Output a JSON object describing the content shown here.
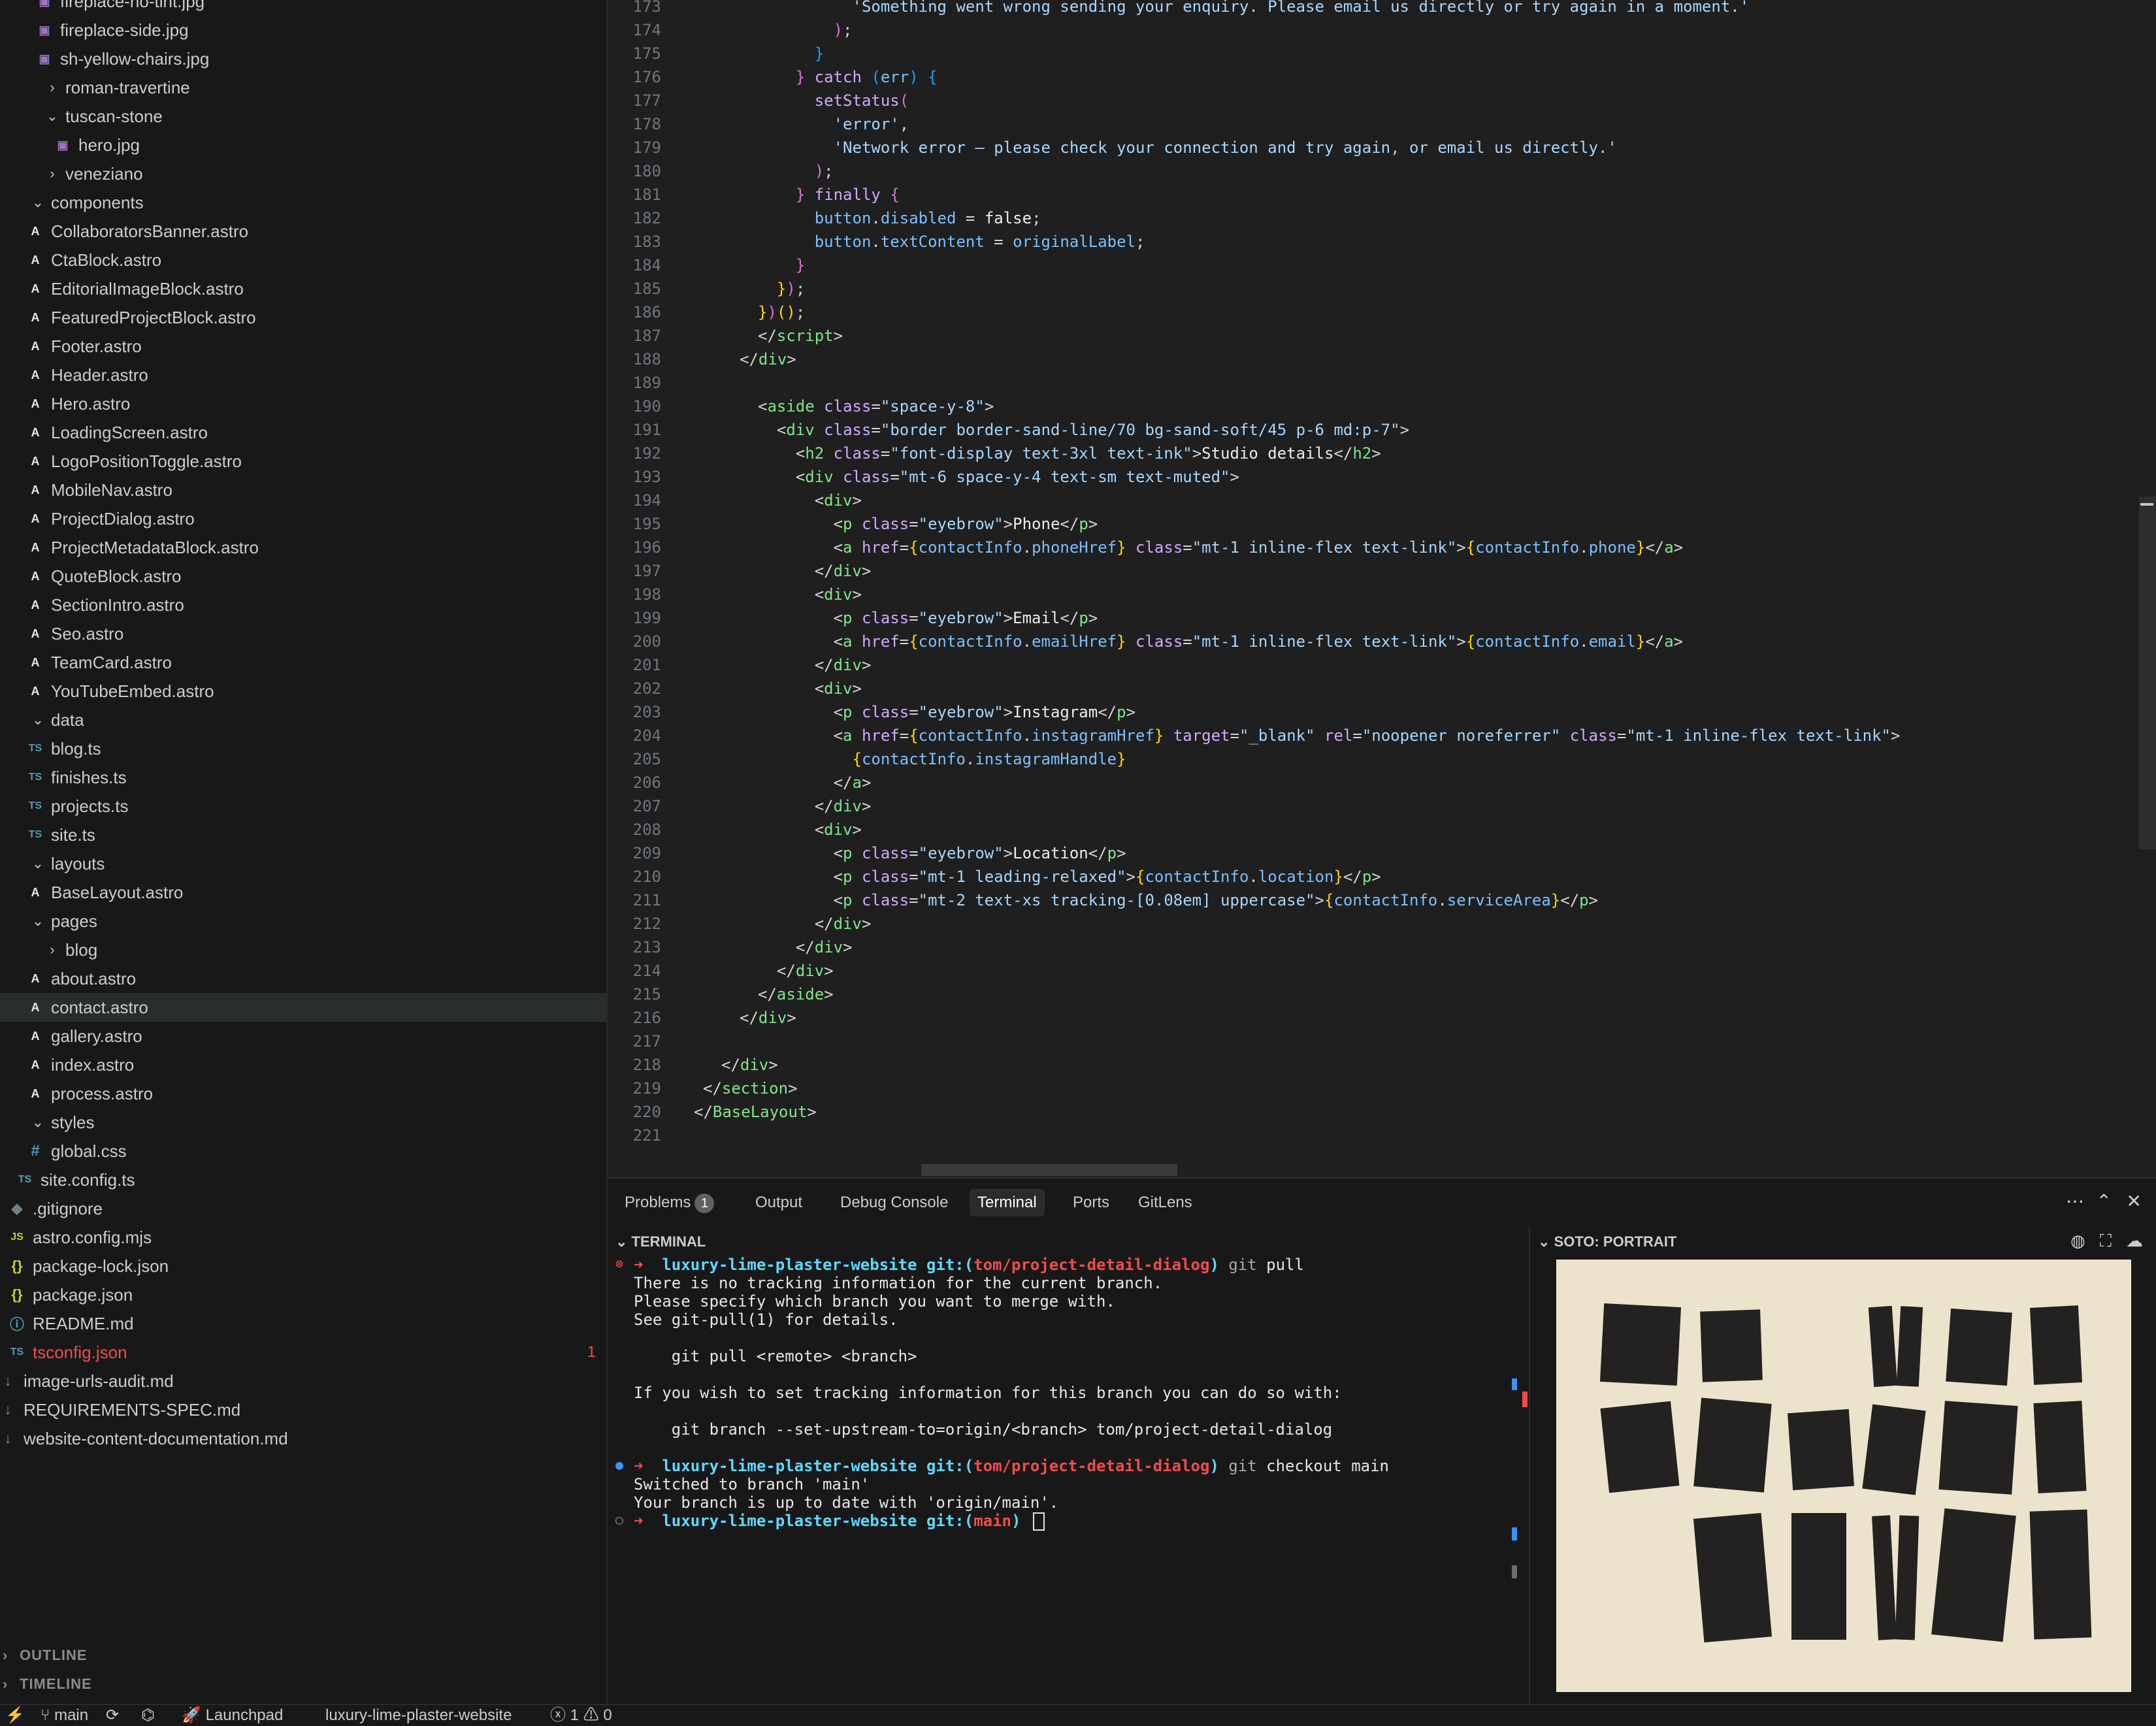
{
  "explorer": {
    "items": [
      {
        "label": "fireplace-no-tint.jpg",
        "type": "img"
      },
      {
        "label": "fireplace-side.jpg",
        "type": "img"
      },
      {
        "label": "sh-yellow-chairs.jpg",
        "type": "img"
      },
      {
        "label": "roman-travertine",
        "type": "folder-closed"
      },
      {
        "label": "tuscan-stone",
        "type": "folder-open"
      },
      {
        "label": "hero.jpg",
        "type": "img"
      },
      {
        "label": "veneziano",
        "type": "folder-closed"
      },
      {
        "label": "components",
        "type": "folder-open"
      },
      {
        "label": "CollaboratorsBanner.astro",
        "type": "astro"
      },
      {
        "label": "CtaBlock.astro",
        "type": "astro"
      },
      {
        "label": "EditorialImageBlock.astro",
        "type": "astro"
      },
      {
        "label": "FeaturedProjectBlock.astro",
        "type": "astro"
      },
      {
        "label": "Footer.astro",
        "type": "astro"
      },
      {
        "label": "Header.astro",
        "type": "astro"
      },
      {
        "label": "Hero.astro",
        "type": "astro"
      },
      {
        "label": "LoadingScreen.astro",
        "type": "astro"
      },
      {
        "label": "LogoPositionToggle.astro",
        "type": "astro"
      },
      {
        "label": "MobileNav.astro",
        "type": "astro"
      },
      {
        "label": "ProjectDialog.astro",
        "type": "astro"
      },
      {
        "label": "ProjectMetadataBlock.astro",
        "type": "astro"
      },
      {
        "label": "QuoteBlock.astro",
        "type": "astro"
      },
      {
        "label": "SectionIntro.astro",
        "type": "astro"
      },
      {
        "label": "Seo.astro",
        "type": "astro"
      },
      {
        "label": "TeamCard.astro",
        "type": "astro"
      },
      {
        "label": "YouTubeEmbed.astro",
        "type": "astro"
      },
      {
        "label": "data",
        "type": "folder-open"
      },
      {
        "label": "blog.ts",
        "type": "ts"
      },
      {
        "label": "finishes.ts",
        "type": "ts"
      },
      {
        "label": "projects.ts",
        "type": "ts"
      },
      {
        "label": "site.ts",
        "type": "ts"
      },
      {
        "label": "layouts",
        "type": "folder-open"
      },
      {
        "label": "BaseLayout.astro",
        "type": "astro"
      },
      {
        "label": "pages",
        "type": "folder-open"
      },
      {
        "label": "blog",
        "type": "folder-closed"
      },
      {
        "label": "about.astro",
        "type": "astro"
      },
      {
        "label": "contact.astro",
        "type": "astro",
        "selected": true
      },
      {
        "label": "gallery.astro",
        "type": "astro"
      },
      {
        "label": "index.astro",
        "type": "astro"
      },
      {
        "label": "process.astro",
        "type": "astro"
      },
      {
        "label": "styles",
        "type": "folder-open"
      },
      {
        "label": "global.css",
        "type": "css"
      },
      {
        "label": "site.config.ts",
        "type": "ts"
      },
      {
        "label": ".gitignore",
        "type": "git"
      },
      {
        "label": "astro.config.mjs",
        "type": "js"
      },
      {
        "label": "package-lock.json",
        "type": "json"
      },
      {
        "label": "package.json",
        "type": "json"
      },
      {
        "label": "README.md",
        "type": "info"
      },
      {
        "label": "tsconfig.json",
        "type": "tsjson",
        "error": true,
        "count": "1"
      },
      {
        "label": "image-urls-audit.md",
        "type": "md"
      },
      {
        "label": "REQUIREMENTS-SPEC.md",
        "type": "md"
      },
      {
        "label": "website-content-documentation.md",
        "type": "md"
      }
    ],
    "outline_label": "OUTLINE",
    "timeline_label": "TIMELINE"
  },
  "editor": {
    "lines": [
      {
        "n": "173",
        "html": "<span class='st'>          'Something went wrong sending your enquiry. Please email us directly or try again in a moment.'</span>"
      },
      {
        "n": "174",
        "html": "        <span class='bp'>)</span>;"
      },
      {
        "n": "175",
        "html": "      <span class='bb'>}</span>"
      },
      {
        "n": "176",
        "html": "    <span class='bp'>}</span> <span class='kw'>catch</span> <span class='bb'>(</span><span class='vr'>err</span><span class='bb'>)</span> <span class='bb'>{</span>"
      },
      {
        "n": "177",
        "html": "      <span class='fn'>setStatus</span><span class='bp'>(</span>"
      },
      {
        "n": "178",
        "html": "        <span class='st'>'error'</span>,"
      },
      {
        "n": "179",
        "html": "        <span class='st'>'Network error — please check your connection and try again, or email us directly.'</span>"
      },
      {
        "n": "180",
        "html": "      <span class='bp'>)</span>;"
      },
      {
        "n": "181",
        "html": "    <span class='bp'>}</span> <span class='kw'>finally</span> <span class='bp'>{</span>"
      },
      {
        "n": "182",
        "html": "      <span class='vr'>button</span>.<span class='vr'>disabled</span> = <span class='tx'>false</span>;"
      },
      {
        "n": "183",
        "html": "      <span class='vr'>button</span>.<span class='vr'>textContent</span> = <span class='vr'>originalLabel</span>;"
      },
      {
        "n": "184",
        "html": "    <span class='bp'>}</span>"
      },
      {
        "n": "185",
        "html": "  <span class='bk'>}</span><span class='bp'>)</span>;"
      },
      {
        "n": "186",
        "html": "<span class='bk'>}</span><span class='bp'>)</span><span class='bk'>()</span>;"
      },
      {
        "n": "187",
        "html": "<span class='tg'>&lt;/</span><span class='tn'>script</span><span class='tg'>&gt;</span>"
      },
      {
        "n": "188",
        "html": "<span class='tg'>&lt;/</span><span class='tn'>div</span><span class='tg'>&gt;</span>"
      },
      {
        "n": "189",
        "html": ""
      },
      {
        "n": "190",
        "html": "<span class='tg'>&lt;</span><span class='tn'>aside</span> <span class='ta'>class</span>=<span class='st'>\"space-y-8\"</span><span class='tg'>&gt;</span>"
      },
      {
        "n": "191",
        "html": "  <span class='tg'>&lt;</span><span class='tn'>div</span> <span class='ta'>class</span>=<span class='st'>\"border border-sand-line/70 bg-sand-soft/45 p-6 md:p-7\"</span><span class='tg'>&gt;</span>"
      },
      {
        "n": "192",
        "html": "    <span class='tg'>&lt;</span><span class='tn'>h2</span> <span class='ta'>class</span>=<span class='st'>\"font-display text-3xl text-ink\"</span><span class='tg'>&gt;</span><span class='tx'>Studio details</span><span class='tg'>&lt;/</span><span class='tn'>h2</span><span class='tg'>&gt;</span>"
      },
      {
        "n": "193",
        "html": "    <span class='tg'>&lt;</span><span class='tn'>div</span> <span class='ta'>class</span>=<span class='st'>\"mt-6 space-y-4 text-sm text-muted\"</span><span class='tg'>&gt;</span>"
      },
      {
        "n": "194",
        "html": "      <span class='tg'>&lt;</span><span class='tn'>div</span><span class='tg'>&gt;</span>"
      },
      {
        "n": "195",
        "html": "        <span class='tg'>&lt;</span><span class='tn'>p</span> <span class='ta'>class</span>=<span class='st'>\"eyebrow\"</span><span class='tg'>&gt;</span><span class='tx'>Phone</span><span class='tg'>&lt;/</span><span class='tn'>p</span><span class='tg'>&gt;</span>"
      },
      {
        "n": "196",
        "html": "        <span class='tg'>&lt;</span><span class='tn'>a</span> <span class='ta'>href</span>=<span class='bk'>{</span><span class='vr'>contactInfo</span>.<span class='vr'>phoneHref</span><span class='bk'>}</span> <span class='ta'>class</span>=<span class='st'>\"mt-1 inline-flex text-link\"</span><span class='tg'>&gt;</span><span class='bk'>{</span><span class='vr'>contactInfo</span>.<span class='vr'>phone</span><span class='bk'>}</span><span class='tg'>&lt;/</span><span class='tn'>a</span><span class='tg'>&gt;</span>"
      },
      {
        "n": "197",
        "html": "      <span class='tg'>&lt;/</span><span class='tn'>div</span><span class='tg'>&gt;</span>"
      },
      {
        "n": "198",
        "html": "      <span class='tg'>&lt;</span><span class='tn'>div</span><span class='tg'>&gt;</span>"
      },
      {
        "n": "199",
        "html": "        <span class='tg'>&lt;</span><span class='tn'>p</span> <span class='ta'>class</span>=<span class='st'>\"eyebrow\"</span><span class='tg'>&gt;</span><span class='tx'>Email</span><span class='tg'>&lt;/</span><span class='tn'>p</span><span class='tg'>&gt;</span>"
      },
      {
        "n": "200",
        "html": "        <span class='tg'>&lt;</span><span class='tn'>a</span> <span class='ta'>href</span>=<span class='bk'>{</span><span class='vr'>contactInfo</span>.<span class='vr'>emailHref</span><span class='bk'>}</span> <span class='ta'>class</span>=<span class='st'>\"mt-1 inline-flex text-link\"</span><span class='tg'>&gt;</span><span class='bk'>{</span><span class='vr'>contactInfo</span>.<span class='vr'>email</span><span class='bk'>}</span><span class='tg'>&lt;/</span><span class='tn'>a</span><span class='tg'>&gt;</span>"
      },
      {
        "n": "201",
        "html": "      <span class='tg'>&lt;/</span><span class='tn'>div</span><span class='tg'>&gt;</span>"
      },
      {
        "n": "202",
        "html": "      <span class='tg'>&lt;</span><span class='tn'>div</span><span class='tg'>&gt;</span>"
      },
      {
        "n": "203",
        "html": "        <span class='tg'>&lt;</span><span class='tn'>p</span> <span class='ta'>class</span>=<span class='st'>\"eyebrow\"</span><span class='tg'>&gt;</span><span class='tx'>Instagram</span><span class='tg'>&lt;/</span><span class='tn'>p</span><span class='tg'>&gt;</span>"
      },
      {
        "n": "204",
        "html": "        <span class='tg'>&lt;</span><span class='tn'>a</span> <span class='ta'>href</span>=<span class='bk'>{</span><span class='vr'>contactInfo</span>.<span class='vr'>instagramHref</span><span class='bk'>}</span> <span class='ta'>target</span>=<span class='st'>\"_blank\"</span> <span class='ta'>rel</span>=<span class='st'>\"noopener noreferrer\"</span> <span class='ta'>class</span>=<span class='st'>\"mt-1 inline-flex text-link\"</span><span class='tg'>&gt;</span>"
      },
      {
        "n": "205",
        "html": "          <span class='bk'>{</span><span class='vr'>contactInfo</span>.<span class='vr'>instagramHandle</span><span class='bk'>}</span>"
      },
      {
        "n": "206",
        "html": "        <span class='tg'>&lt;/</span><span class='tn'>a</span><span class='tg'>&gt;</span>"
      },
      {
        "n": "207",
        "html": "      <span class='tg'>&lt;/</span><span class='tn'>div</span><span class='tg'>&gt;</span>"
      },
      {
        "n": "208",
        "html": "      <span class='tg'>&lt;</span><span class='tn'>div</span><span class='tg'>&gt;</span>"
      },
      {
        "n": "209",
        "html": "        <span class='tg'>&lt;</span><span class='tn'>p</span> <span class='ta'>class</span>=<span class='st'>\"eyebrow\"</span><span class='tg'>&gt;</span><span class='tx'>Location</span><span class='tg'>&lt;/</span><span class='tn'>p</span><span class='tg'>&gt;</span>"
      },
      {
        "n": "210",
        "html": "        <span class='tg'>&lt;</span><span class='tn'>p</span> <span class='ta'>class</span>=<span class='st'>\"mt-1 leading-relaxed\"</span><span class='tg'>&gt;</span><span class='bk'>{</span><span class='vr'>contactInfo</span>.<span class='vr'>location</span><span class='bk'>}</span><span class='tg'>&lt;/</span><span class='tn'>p</span><span class='tg'>&gt;</span>"
      },
      {
        "n": "211",
        "html": "        <span class='tg'>&lt;</span><span class='tn'>p</span> <span class='ta'>class</span>=<span class='st'>\"mt-2 text-xs tracking-[0.08em] uppercase\"</span><span class='tg'>&gt;</span><span class='bk'>{</span><span class='vr'>contactInfo</span>.<span class='vr'>serviceArea</span><span class='bk'>}</span><span class='tg'>&lt;/</span><span class='tn'>p</span><span class='tg'>&gt;</span>"
      },
      {
        "n": "212",
        "html": "      <span class='tg'>&lt;/</span><span class='tn'>div</span><span class='tg'>&gt;</span>"
      },
      {
        "n": "213",
        "html": "    <span class='tg'>&lt;/</span><span class='tn'>div</span><span class='tg'>&gt;</span>"
      },
      {
        "n": "214",
        "html": "  <span class='tg'>&lt;/</span><span class='tn'>div</span><span class='tg'>&gt;</span>"
      },
      {
        "n": "215",
        "html": "<span class='tg'>&lt;/</span><span class='tn'>aside</span><span class='tg'>&gt;</span>"
      },
      {
        "n": "216",
        "html": "<span class='tg'>&lt;/</span><span class='tn'>div</span><span class='tg'>&gt;</span>"
      },
      {
        "n": "217",
        "html": ""
      },
      {
        "n": "218",
        "html": "<span class='tg'>&lt;/</span><span class='tn'>div</span><span class='tg'>&gt;</span>"
      },
      {
        "n": "219",
        "html": "<span class='tg'>&lt;/</span><span class='tn'>section</span><span class='tg'>&gt;</span>"
      },
      {
        "n": "220",
        "html": "<span class='tg'>&lt;/</span><span class='tn'>BaseLayout</span><span class='tg'>&gt;</span>"
      },
      {
        "n": "221",
        "html": ""
      }
    ]
  },
  "panel": {
    "tabs": [
      {
        "label": "Problems",
        "badge": "1"
      },
      {
        "label": "Output"
      },
      {
        "label": "Debug Console"
      },
      {
        "label": "Terminal",
        "active": true
      },
      {
        "label": "Ports"
      },
      {
        "label": "GitLens"
      }
    ],
    "terminal_title": "TERMINAL",
    "soto_title": "SOTO: PORTRAIT"
  },
  "terminal": {
    "repo": "luxury-lime-plaster-website",
    "lines": [
      {
        "kind": "prompt",
        "mark": "⊗",
        "mark_color": "#f14c4c",
        "branch": "tom/project-detail-dialog",
        "cmd": "git",
        "arg": "pull"
      },
      {
        "kind": "out",
        "text": "There is no tracking information for the current branch."
      },
      {
        "kind": "out",
        "text": "Please specify which branch you want to merge with."
      },
      {
        "kind": "out",
        "text": "See git-pull(1) for details."
      },
      {
        "kind": "out",
        "text": ""
      },
      {
        "kind": "out",
        "text": "    git pull <remote> <branch>"
      },
      {
        "kind": "out",
        "text": ""
      },
      {
        "kind": "out",
        "text": "If you wish to set tracking information for this branch you can do so with:"
      },
      {
        "kind": "out",
        "text": ""
      },
      {
        "kind": "out",
        "text": "    git branch --set-upstream-to=origin/<branch> tom/project-detail-dialog"
      },
      {
        "kind": "out",
        "text": ""
      },
      {
        "kind": "prompt",
        "mark": "●",
        "mark_color": "#3794ff",
        "branch": "tom/project-detail-dialog",
        "cmd": "git",
        "arg": "checkout main"
      },
      {
        "kind": "out",
        "text": "Switched to branch 'main'"
      },
      {
        "kind": "out",
        "text": "Your branch is up to date with 'origin/main'."
      },
      {
        "kind": "prompt",
        "mark": "○",
        "mark_color": "#8b8b8b",
        "branch": "main",
        "cmd": "",
        "arg": "",
        "cursor": true
      }
    ]
  },
  "statusbar": {
    "branch": "main",
    "launchpad": "Launchpad",
    "workspace": "luxury-lime-plaster-website",
    "errors": "1",
    "warnings": "0"
  },
  "colors": {
    "accent": "#0078d4",
    "error": "#f14c4c",
    "portrait_bg": "#ebe3cc",
    "portrait_block": "#242220"
  }
}
